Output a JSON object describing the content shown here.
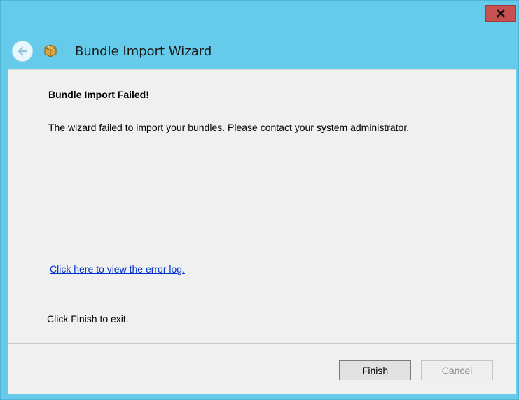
{
  "window": {
    "title": "Bundle Import Wizard",
    "close_glyph": "x",
    "accent_color": "#66cbea",
    "close_color": "#c75050"
  },
  "icons": {
    "back": "back-arrow-icon",
    "app": "package-box-icon",
    "close": "close-icon"
  },
  "content": {
    "heading": "Bundle Import Failed!",
    "message": "The wizard failed to import your bundles. Please contact your system administrator.",
    "error_link": "Click here to view the error log.",
    "exit_text": "Click Finish to exit."
  },
  "footer": {
    "finish_label": "Finish",
    "cancel_label": "Cancel",
    "cancel_enabled": false
  }
}
